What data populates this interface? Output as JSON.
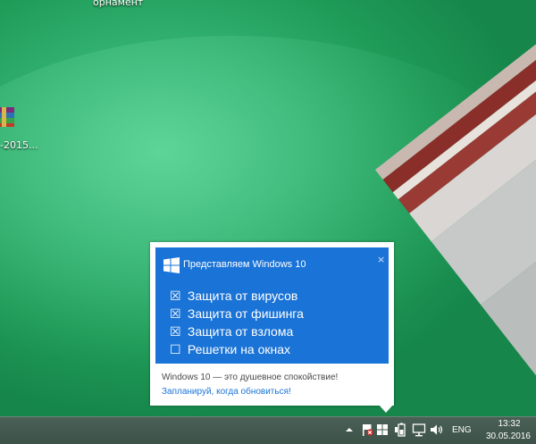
{
  "desktop": {
    "top_icon_label": "орнамент",
    "archive_icon_label": "-2015..."
  },
  "notification": {
    "title": "Представляем Windows 10",
    "close": "×",
    "items": [
      {
        "box": "☒",
        "label": "Защита от вирусов"
      },
      {
        "box": "☒",
        "label": "Защита от фишинга"
      },
      {
        "box": "☒",
        "label": "Защита от взлома"
      },
      {
        "box": "☐",
        "label": "Решетки на окнах"
      }
    ],
    "message": "Windows 10 — это душевное спокойствие!",
    "link": "Запланируй, когда обновиться!"
  },
  "taskbar": {
    "language": "ENG",
    "time": "13:32",
    "date": "30.05.2016",
    "icons": [
      "chevron-up-icon",
      "flag-error-icon",
      "windows-icon",
      "battery-icon",
      "network-icon",
      "volume-icon"
    ]
  },
  "colors": {
    "popup_blue": "#1a73d6",
    "desktop_green": "#1f9a55",
    "taskbar": "#44594f"
  }
}
